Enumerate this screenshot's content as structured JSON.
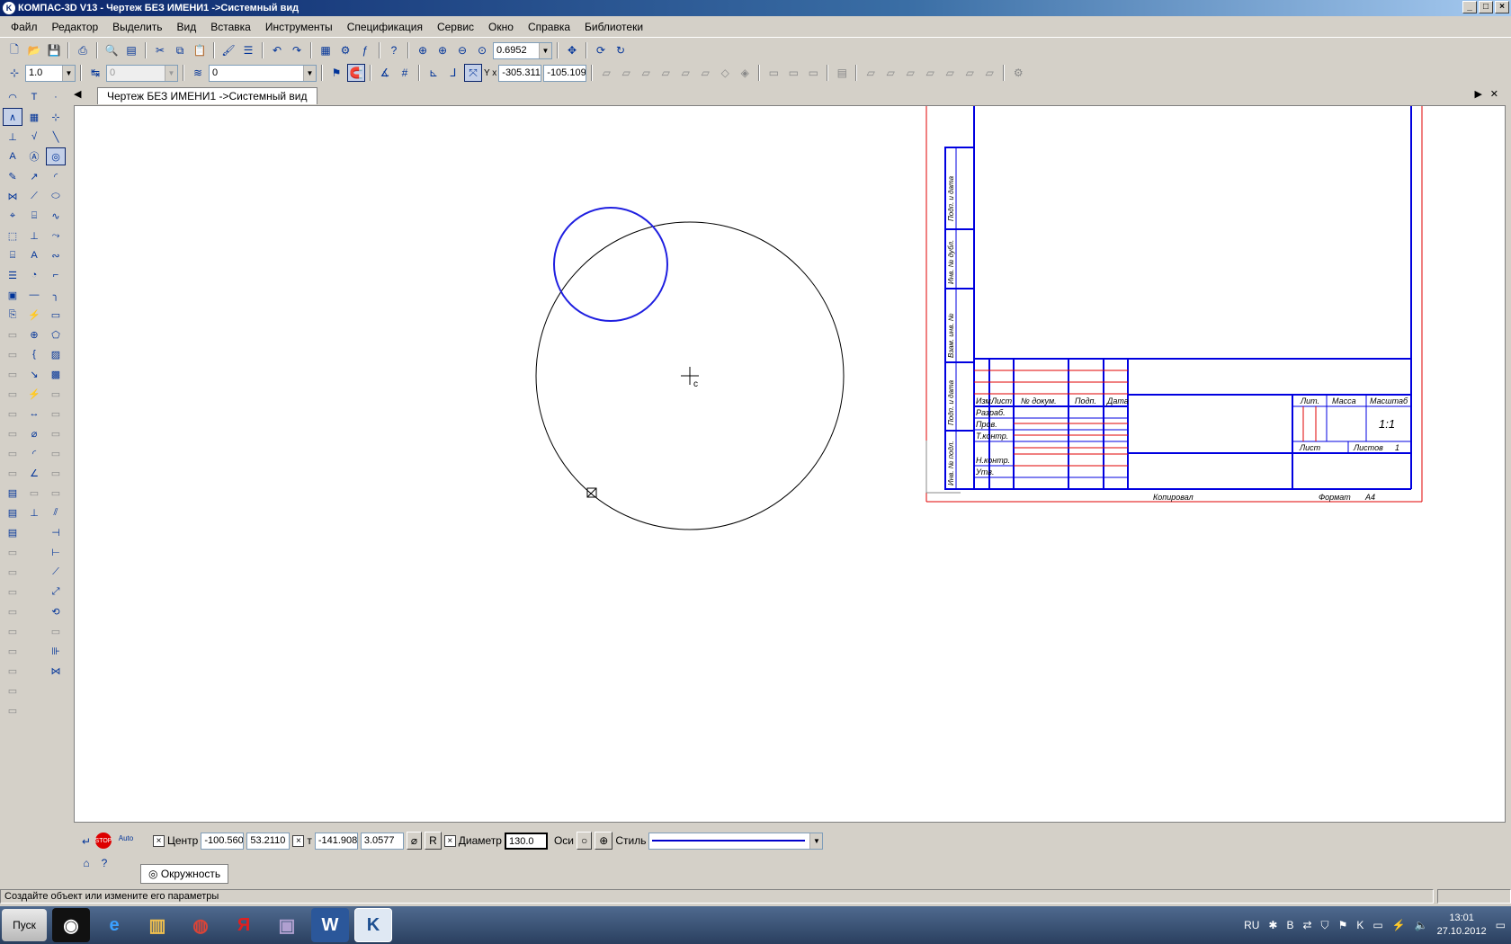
{
  "window": {
    "title": "КОМПАС-3D V13 - Чертеж БЕЗ ИМЕНИ1 ->Системный вид",
    "logo": "K"
  },
  "menu": [
    "Файл",
    "Редактор",
    "Выделить",
    "Вид",
    "Вставка",
    "Инструменты",
    "Спецификация",
    "Сервис",
    "Окно",
    "Справка",
    "Библиотеки"
  ],
  "toolbar1": {
    "zoom_value": "0.6952"
  },
  "toolbar2": {
    "scale_value": "1.0",
    "step_value": "0",
    "layer_value": "0",
    "coord_x": "-305.311",
    "coord_y": "-105.109"
  },
  "document": {
    "tab_label": "Чертеж БЕЗ ИМЕНИ1 ->Системный вид"
  },
  "title_block": {
    "side_labels": [
      "Подп. и дата",
      "Инв. № дубл.",
      "Взам. инв. №",
      "Подп. и дата",
      "Инв. № подл."
    ],
    "header_cols": [
      "Изм.",
      "Лист",
      "№ докум.",
      "Подп.",
      "Дата"
    ],
    "rows": [
      "Разраб.",
      "Пров.",
      "Т.контр.",
      "Н.контр.",
      "Утв."
    ],
    "lit_label": "Лит.",
    "mass_label": "Масса",
    "scale_label": "Масштаб",
    "scale_value": "1:1",
    "sheet_label": "Лист",
    "sheets_label": "Листов",
    "sheets_value": "1",
    "copied_label": "Копировал",
    "format_label": "Формат",
    "format_value": "A4"
  },
  "params": {
    "center_label": "Центр",
    "center_x": "-100.560",
    "center_y": "53.2110",
    "t_label": "т",
    "t_x": "-141.908",
    "t_y": "3.0577",
    "r_label": "R",
    "diameter_label": "Диаметр",
    "diameter_value": "130.0",
    "axes_label": "Оси",
    "style_label": "Стиль",
    "stop_label": "STOP",
    "auto_label": "Auto"
  },
  "object_tab": {
    "label": "Окружность"
  },
  "status": {
    "text": "Создайте объект или измените его параметры"
  },
  "taskbar": {
    "start_label": "Пуск",
    "lang": "RU",
    "time": "13:01",
    "date": "27.10.2012"
  },
  "colors": {
    "blue_circle": "#1f1fe0",
    "frame_blue": "#0000e0",
    "frame_red": "#e00000",
    "canvas_bg": "#ffffff"
  }
}
